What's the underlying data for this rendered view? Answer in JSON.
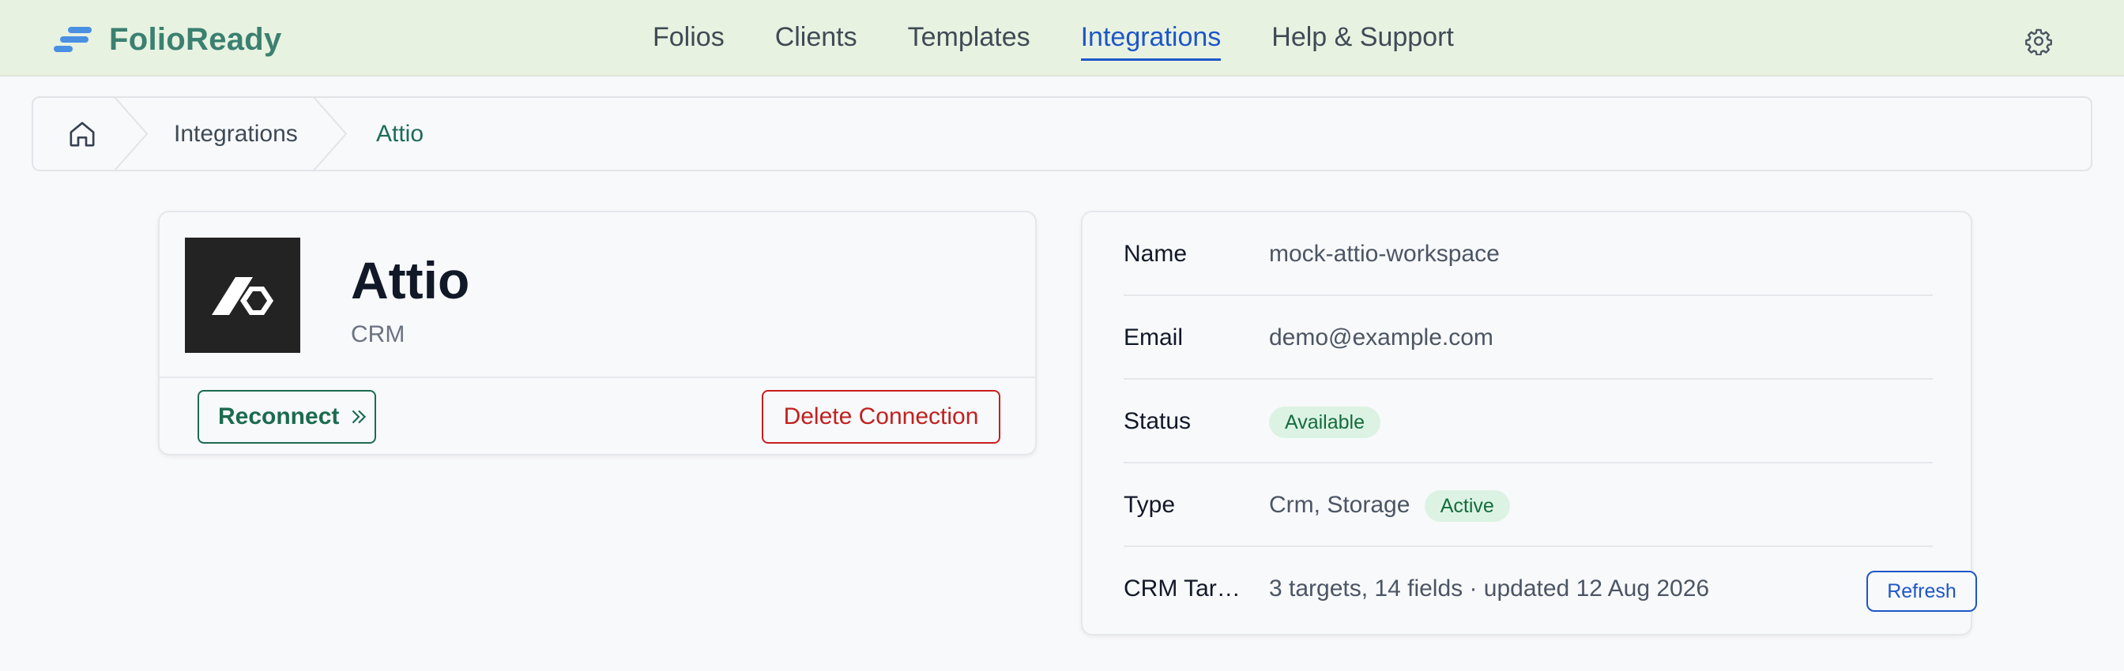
{
  "brand": {
    "name": "FolioReady"
  },
  "nav": {
    "items": [
      {
        "label": "Folios"
      },
      {
        "label": "Clients"
      },
      {
        "label": "Templates"
      },
      {
        "label": "Integrations",
        "active": true
      },
      {
        "label": "Help & Support"
      }
    ]
  },
  "breadcrumb": {
    "items": [
      "Integrations",
      "Attio"
    ]
  },
  "integration": {
    "name": "Attio",
    "category": "CRM",
    "reconnect_label": "Reconnect",
    "delete_label": "Delete Connection"
  },
  "details": {
    "rows": [
      {
        "label": "Name",
        "value": "mock-attio-workspace"
      },
      {
        "label": "Email",
        "value": "demo@example.com"
      },
      {
        "label": "Status",
        "badge": "Available"
      },
      {
        "label": "Type",
        "value": "Crm, Storage",
        "badge": "Active"
      },
      {
        "label": "CRM Targets",
        "value": "3 targets, 14 fields · updated 12 Aug 2026",
        "action": "Refresh"
      }
    ]
  },
  "colors": {
    "brand": "#3b8070",
    "accent": "#1e56c8",
    "danger": "#c81e1e",
    "success_bg": "#dcf3e4"
  }
}
